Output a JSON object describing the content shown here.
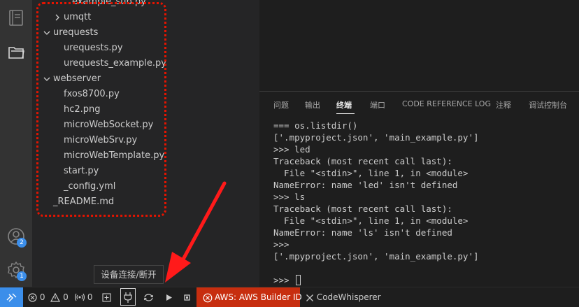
{
  "explorer": {
    "items": [
      {
        "label": "example_sub.py",
        "indent": 2,
        "chevron": "none"
      },
      {
        "label": "umqtt",
        "indent": 1,
        "chevron": "right"
      },
      {
        "label": "urequests",
        "indent": 0,
        "chevron": "down"
      },
      {
        "label": "urequests.py",
        "indent": 1,
        "chevron": "none"
      },
      {
        "label": "urequests_example.py",
        "indent": 1,
        "chevron": "none"
      },
      {
        "label": "webserver",
        "indent": 0,
        "chevron": "down"
      },
      {
        "label": "fxos8700.py",
        "indent": 1,
        "chevron": "none"
      },
      {
        "label": "hc2.png",
        "indent": 1,
        "chevron": "none"
      },
      {
        "label": "microWebSocket.py",
        "indent": 1,
        "chevron": "none"
      },
      {
        "label": "microWebSrv.py",
        "indent": 1,
        "chevron": "none"
      },
      {
        "label": "microWebTemplate.py",
        "indent": 1,
        "chevron": "none"
      },
      {
        "label": "start.py",
        "indent": 1,
        "chevron": "none"
      },
      {
        "label": "_config.yml",
        "indent": 1,
        "chevron": "none"
      },
      {
        "label": "_README.md",
        "indent": 0,
        "chevron": "none"
      }
    ]
  },
  "activity": {
    "accounts_badge": "2",
    "settings_badge": "1"
  },
  "panel": {
    "tabs": [
      {
        "label": "问题"
      },
      {
        "label": "输出"
      },
      {
        "label": "终端"
      },
      {
        "label": "端口"
      },
      {
        "label": "CODE REFERENCE LOG"
      },
      {
        "label": "注释"
      },
      {
        "label": "调试控制台"
      }
    ],
    "active_tab": "终端",
    "terminal_lines": [
      "=== os.listdir()",
      "['.mpyproject.json', 'main_example.py']",
      ">>> led",
      "Traceback (most recent call last):",
      "  File \"<stdin>\", line 1, in <module>",
      "NameError: name 'led' isn't defined",
      ">>> ls",
      "Traceback (most recent call last):",
      "  File \"<stdin>\", line 1, in <module>",
      "NameError: name 'ls' isn't defined",
      ">>>",
      "['.mpyproject.json', 'main_example.py']",
      "",
      ">>> "
    ]
  },
  "statusbar": {
    "errors": "0",
    "warnings": "0",
    "ports": "0",
    "aws_label": "AWS: AWS Builder ID",
    "codewhisperer_label": "CodeWhisperer"
  },
  "tooltip": {
    "text": "设备连接/断开"
  },
  "colors": {
    "activity_bg": "#333333",
    "sidebar_bg": "#252526",
    "editor_bg": "#1e1e1e",
    "remote_accent": "#3b8eea",
    "aws_bg": "#c72e0f",
    "annotation_red": "#e51400"
  }
}
